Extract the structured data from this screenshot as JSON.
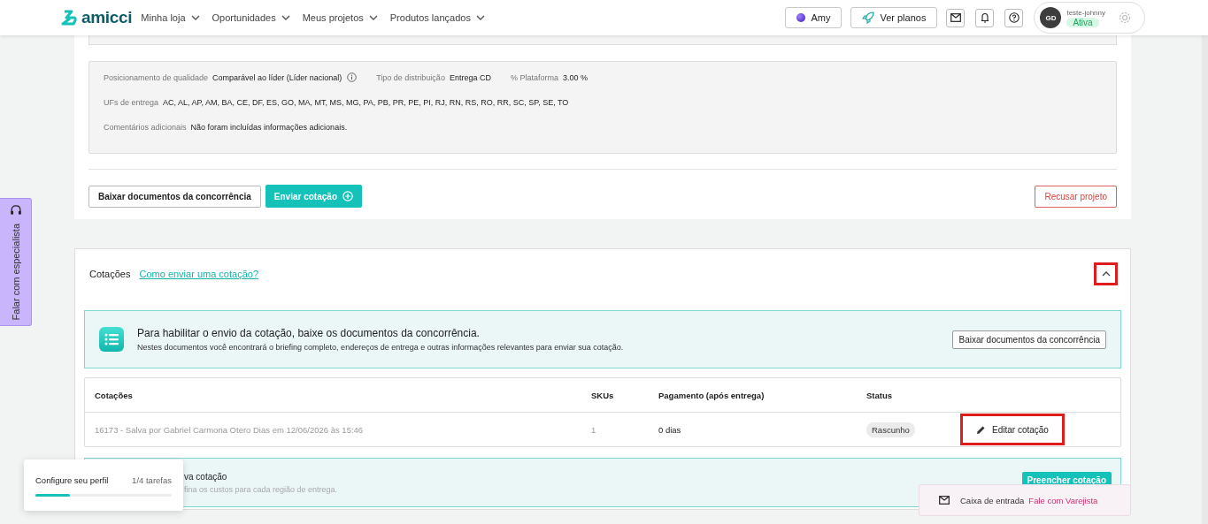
{
  "topbar": {
    "logo": "amicci",
    "nav": [
      {
        "label": "Minha loja"
      },
      {
        "label": "Oportunidades"
      },
      {
        "label": "Meus projetos"
      },
      {
        "label": "Produtos lançados"
      }
    ],
    "amy_button": "Amy",
    "plans_button": "Ver planos",
    "user": {
      "initials": "GD",
      "name": "teste-johnny",
      "status": "Ativa"
    }
  },
  "details": {
    "fields": [
      {
        "label": "Posicionamento de qualidade",
        "value": "Comparável ao líder (Líder nacional)",
        "info": true
      },
      {
        "label": "Tipo de distribuição",
        "value": "Entrega CD",
        "info": false
      },
      {
        "label": "% Plataforma",
        "value": "3.00 %",
        "info": false
      }
    ],
    "rows": [
      {
        "label": "UFs de entrega",
        "value": "AC, AL, AP, AM, BA, CE, DF, ES, GO, MA, MT, MS, MG, PA, PB, PR, PE, PI, RJ, RN, RS, RO, RR, SC, SP, SE, TO"
      },
      {
        "label": "Comentários adicionais",
        "value": "Não foram incluídas informações adicionais."
      }
    ],
    "download_button": "Baixar documentos da concorrência",
    "send_button": "Enviar cotação",
    "refuse_button": "Recusar projeto"
  },
  "quotes": {
    "title": "Cotações",
    "help_link": "Como enviar uma cotação?",
    "expanded": true,
    "toggle_highlighted": true,
    "notice": {
      "title": "Para habilitar o envio da cotação, baixe os documentos da concorrência.",
      "text": "Nestes documentos você encontrará o briefing completo, endereços de entrega e outras informações relevantes para enviar sua cotação.",
      "button": "Baixar documentos da concorrência"
    },
    "table": {
      "columns": [
        "Cotações",
        "SKUs",
        "Pagamento (após entrega)",
        "Status"
      ],
      "rows": [
        {
          "quote": "16173 - Salva por Gabriel Carmona Otero Dias em 12/06/2026 às 15:46",
          "skus": "1",
          "payment": "0 dias",
          "status": "Rascunho",
          "action": "Editar cotação",
          "highlighted": true
        }
      ]
    },
    "new_quote": {
      "title": "va cotação",
      "text": "fina os custos para cada região de entrega.",
      "button": "Preencher cotação"
    }
  },
  "specialist_tab": "Falar com especialista",
  "profile_popup": {
    "title": "Configure seu perfil",
    "count": "1/4 tarefas",
    "level": 0.25
  },
  "inbox_popup": {
    "label": "Caixa de entrada",
    "link": "Fale com Varejista"
  }
}
